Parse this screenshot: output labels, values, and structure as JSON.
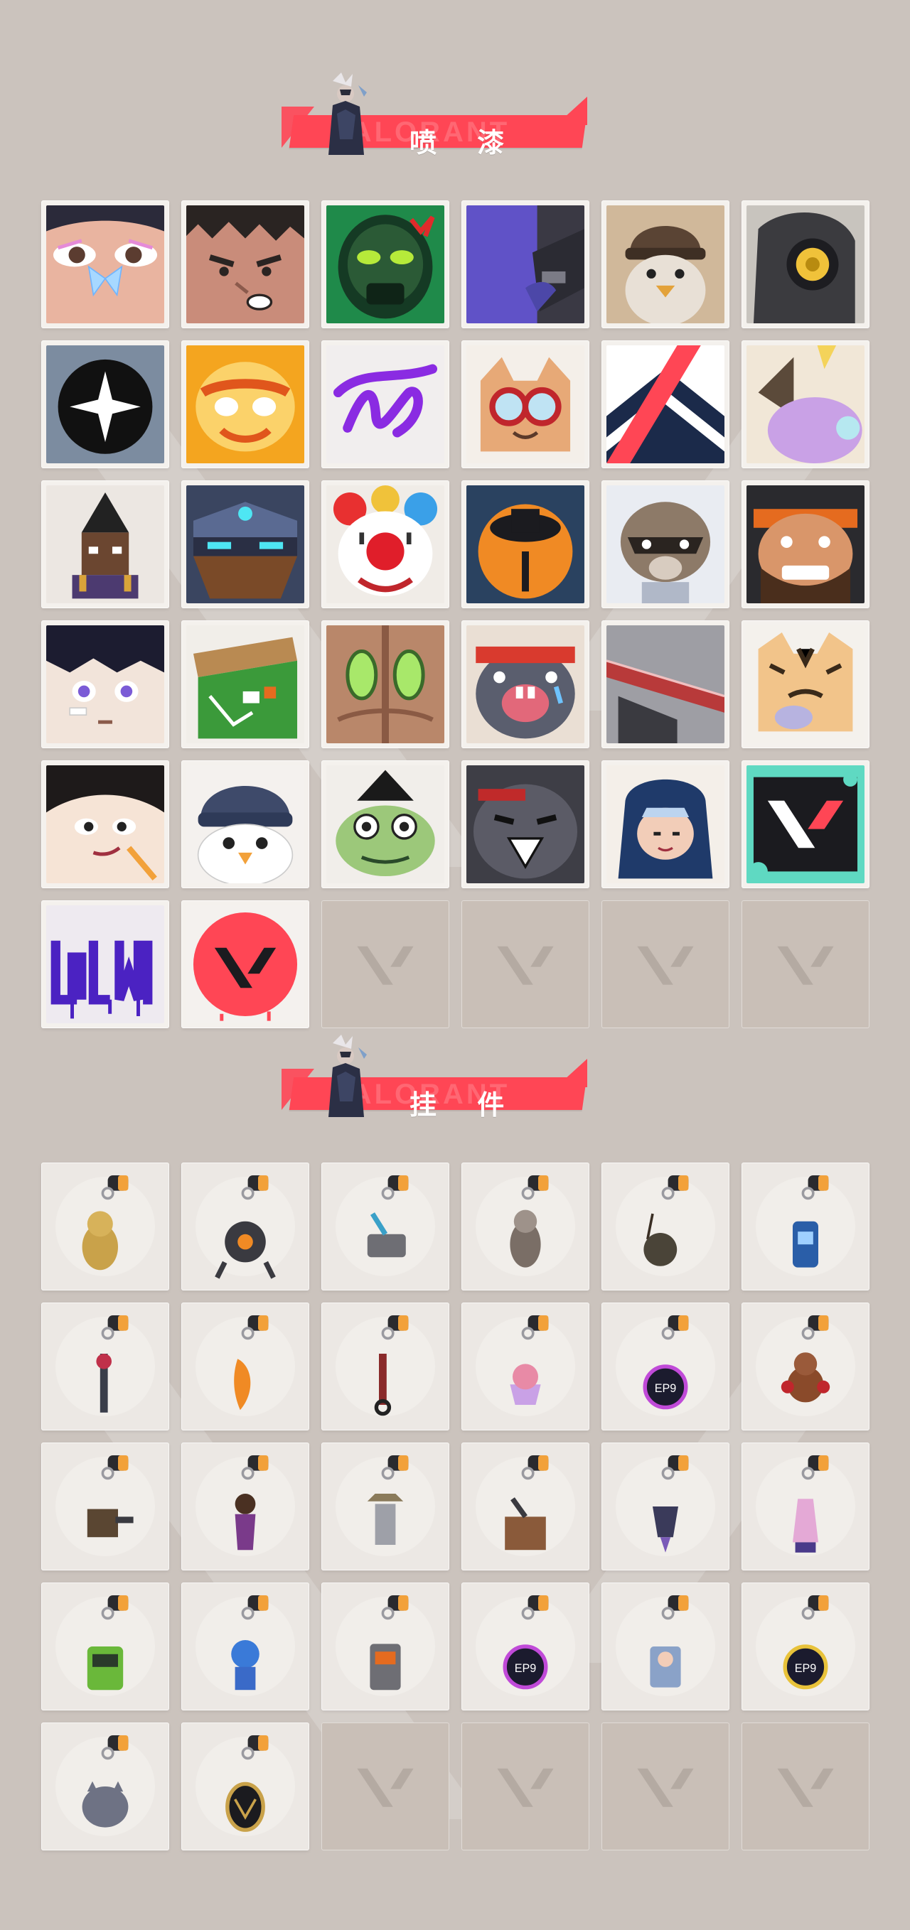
{
  "sections": {
    "sprays": {
      "title": "喷 漆",
      "watermark": "VALORANT"
    },
    "charms": {
      "title": "挂 件",
      "watermark": "VALORANT"
    }
  },
  "colors": {
    "background": "#cbc3bd",
    "accent": "#ff4655",
    "tile": "#f4f1ed",
    "empty_tile": "#c9bfb7"
  },
  "spray_items": [
    "eye-butterfly-spray",
    "angry-face-spray",
    "green-mask-spray",
    "purple-gun-spray",
    "penguin-beanie-spray",
    "robot-eye-spray",
    "star-emblem-spray",
    "tiger-mask-spray",
    "purple-scribble-spray",
    "goggle-cat-spray",
    "chevron-stripes-spray",
    "horned-blob-spray",
    "pixel-agent-spray",
    "armored-face-spray",
    "clown-spray",
    "orange-sphere-spray",
    "raccoon-spray",
    "bearded-grin-spray",
    "anime-boy-spray",
    "green-crate-spray",
    "green-eyes-spray",
    "crying-creature-spray",
    "red-blade-spray",
    "tiger-cub-spray",
    "smirk-girl-spray",
    "penguin-hat-spray",
    "frog-witch-spray",
    "grey-cat-spray",
    "hooded-agent-spray",
    "valorant-logo-spray",
    "graffiti-tag-spray",
    "red-v-spray"
  ],
  "spray_empty_slots": 4,
  "charm_items": [
    "gold-cat-charm",
    "drone-charm",
    "mini-grill-charm",
    "armored-cat-charm",
    "satchel-charm",
    "canister-charm",
    "chainsaw-charm",
    "chili-charm",
    "rope-charm",
    "cupcake-charm",
    "ep9-coin-charm",
    "teddy-bear-charm",
    "turret-charm",
    "agent-figure-charm",
    "cowboy-robot-charm",
    "crate-charm",
    "jester-charm",
    "lava-lamp-charm",
    "gameboy-charm",
    "astronaut-charm",
    "radio-charm",
    "ep9-coin-charm-2",
    "robot-girl-charm",
    "ep9-coin-charm-3",
    "grey-cat-charm",
    "v-coin-charm"
  ],
  "charm_empty_slots": 4
}
